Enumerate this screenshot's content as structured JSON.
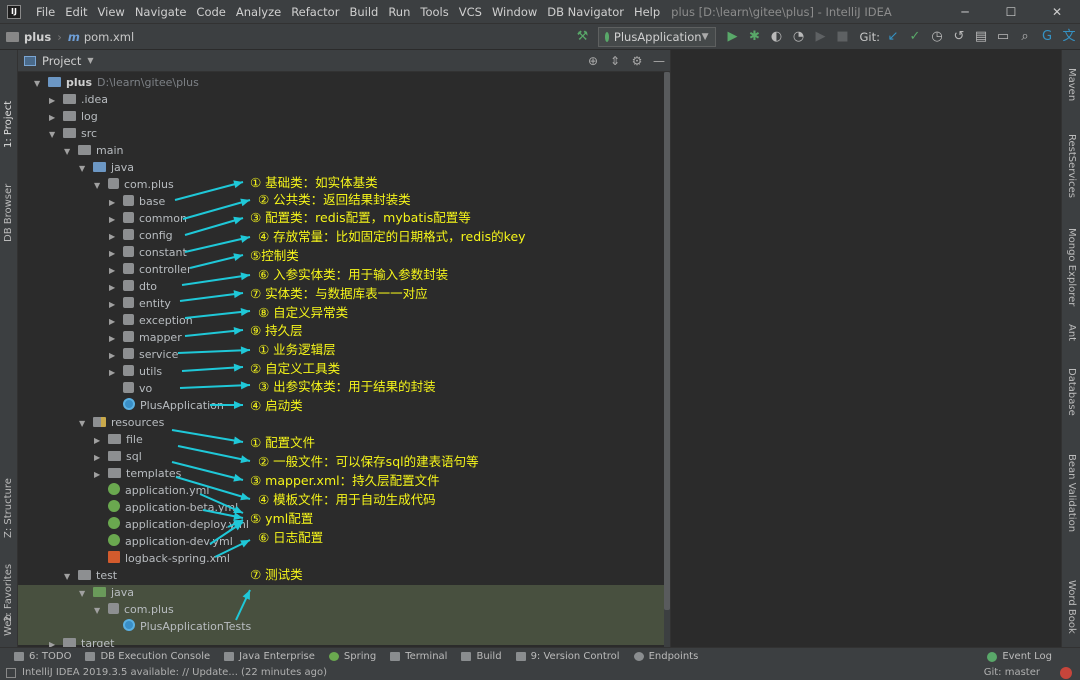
{
  "titlebar": {
    "menu": [
      "File",
      "Edit",
      "View",
      "Navigate",
      "Code",
      "Analyze",
      "Refactor",
      "Build",
      "Run",
      "Tools",
      "VCS",
      "Window",
      "DB Navigator",
      "Help"
    ],
    "window_title": "plus [D:\\learn\\gitee\\plus] - IntelliJ IDEA",
    "controls": [
      "─",
      "☐",
      "✕"
    ]
  },
  "navbar": {
    "project": "plus",
    "file": "pom.xml",
    "run_config": "PlusApplication",
    "git_label": "Git:"
  },
  "left_tabs": [
    "1: Project",
    "DB Browser",
    "Z: Structure",
    "2: Favorites",
    "Web"
  ],
  "right_tabs": [
    "Maven",
    "RestServices",
    "Mongo Explorer",
    "Ant",
    "Database",
    "Bean Validation",
    "Word Book"
  ],
  "project_panel": {
    "title": "Project"
  },
  "tree": [
    {
      "label": "plus",
      "path": "D:\\learn\\gitee\\plus",
      "depth": 0,
      "arrow": "open",
      "icon": "folder-module",
      "bold": true
    },
    {
      "label": ".idea",
      "depth": 1,
      "arrow": "closed",
      "icon": "folder"
    },
    {
      "label": "log",
      "depth": 1,
      "arrow": "closed",
      "icon": "folder"
    },
    {
      "label": "src",
      "depth": 1,
      "arrow": "open",
      "icon": "folder"
    },
    {
      "label": "main",
      "depth": 2,
      "arrow": "open",
      "icon": "folder"
    },
    {
      "label": "java",
      "depth": 3,
      "arrow": "open",
      "icon": "folder-source"
    },
    {
      "label": "com.plus",
      "depth": 4,
      "arrow": "open",
      "icon": "package"
    },
    {
      "label": "base",
      "depth": 5,
      "arrow": "closed",
      "icon": "package"
    },
    {
      "label": "common",
      "depth": 5,
      "arrow": "closed",
      "icon": "package"
    },
    {
      "label": "config",
      "depth": 5,
      "arrow": "closed",
      "icon": "package"
    },
    {
      "label": "constant",
      "depth": 5,
      "arrow": "closed",
      "icon": "package"
    },
    {
      "label": "controller",
      "depth": 5,
      "arrow": "closed",
      "icon": "package"
    },
    {
      "label": "dto",
      "depth": 5,
      "arrow": "closed",
      "icon": "package"
    },
    {
      "label": "entity",
      "depth": 5,
      "arrow": "closed",
      "icon": "package"
    },
    {
      "label": "exception",
      "depth": 5,
      "arrow": "closed",
      "icon": "package"
    },
    {
      "label": "mapper",
      "depth": 5,
      "arrow": "closed",
      "icon": "package"
    },
    {
      "label": "service",
      "depth": 5,
      "arrow": "closed",
      "icon": "package"
    },
    {
      "label": "utils",
      "depth": 5,
      "arrow": "closed",
      "icon": "package"
    },
    {
      "label": "vo",
      "depth": 5,
      "arrow": "none",
      "icon": "package"
    },
    {
      "label": "PlusApplication",
      "depth": 5,
      "arrow": "none",
      "icon": "class"
    },
    {
      "label": "resources",
      "depth": 3,
      "arrow": "open",
      "icon": "folder-resources"
    },
    {
      "label": "file",
      "depth": 4,
      "arrow": "closed",
      "icon": "folder"
    },
    {
      "label": "sql",
      "depth": 4,
      "arrow": "closed",
      "icon": "folder"
    },
    {
      "label": "templates",
      "depth": 4,
      "arrow": "closed",
      "icon": "folder"
    },
    {
      "label": "application.yml",
      "depth": 4,
      "arrow": "none",
      "icon": "spring"
    },
    {
      "label": "application-beta.yml",
      "depth": 4,
      "arrow": "none",
      "icon": "spring"
    },
    {
      "label": "application-deploy.yml",
      "depth": 4,
      "arrow": "none",
      "icon": "spring"
    },
    {
      "label": "application-dev.yml",
      "depth": 4,
      "arrow": "none",
      "icon": "spring"
    },
    {
      "label": "logback-spring.xml",
      "depth": 4,
      "arrow": "none",
      "icon": "xml"
    },
    {
      "label": "test",
      "depth": 2,
      "arrow": "open",
      "icon": "folder"
    },
    {
      "label": "java",
      "depth": 3,
      "arrow": "open",
      "icon": "folder-test"
    },
    {
      "label": "com.plus",
      "depth": 4,
      "arrow": "open",
      "icon": "package"
    },
    {
      "label": "PlusApplicationTests",
      "depth": 5,
      "arrow": "none",
      "icon": "class"
    },
    {
      "label": "target",
      "depth": 1,
      "arrow": "closed",
      "icon": "folder"
    }
  ],
  "annotations": [
    "① 基础类：如实体基类",
    "② 公共类：返回结果封装类",
    "③ 配置类：redis配置，mybatis配置等",
    "④ 存放常量：比如固定的日期格式，redis的key",
    "⑤控制类",
    "⑥ 入参实体类：用于输入参数封装",
    "⑦ 实体类：与数据库表一一对应",
    "⑧ 自定义异常类",
    "⑨ 持久层",
    "① 业务逻辑层",
    "② 自定义工具类",
    "③ 出参实体类：用于结果的封装",
    "④ 启动类",
    "① 配置文件",
    "② 一般文件：可以保存sql的建表语句等",
    "③ mapper.xml：持久层配置文件",
    "④ 模板文件：用于自动生成代码",
    "⑤ yml配置",
    "⑥ 日志配置",
    "⑦ 测试类"
  ],
  "bottom_tools": [
    "6: TODO",
    "DB Execution Console",
    "Java Enterprise",
    "Spring",
    "Terminal",
    "Build",
    "9: Version Control",
    "Endpoints"
  ],
  "event_log": "Event Log",
  "status": {
    "message": "IntelliJ IDEA 2019.3.5 available: // Update... (22 minutes ago)",
    "git_branch": "Git: master"
  },
  "colors": {
    "annotation_text": "#f5f51a",
    "annotation_arrow": "#1fc8d8",
    "tree_bg": "#2b2b2b",
    "panel_bg": "#3c3f41",
    "test_highlight": "#48503f"
  }
}
